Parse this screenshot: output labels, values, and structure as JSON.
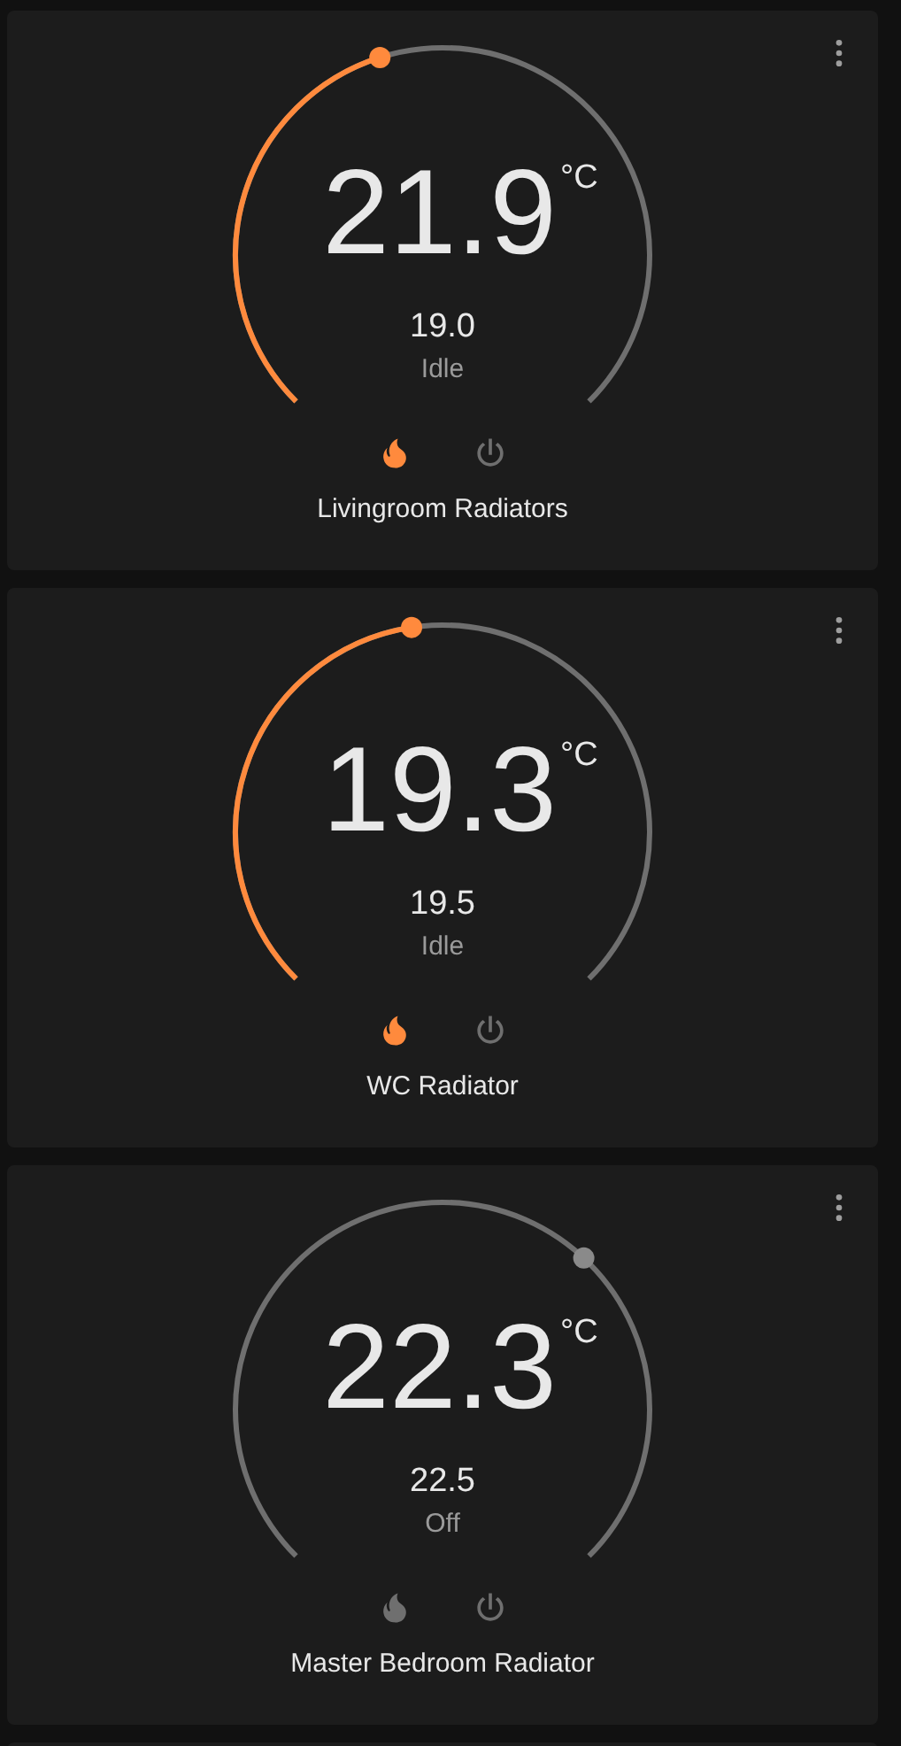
{
  "cards": [
    {
      "name": "Livingroom Radiators",
      "current": "21.9",
      "unit": "°C",
      "target": "19.0",
      "status": "Idle",
      "heating": true
    },
    {
      "name": "WC Radiator",
      "current": "19.3",
      "unit": "°C",
      "target": "19.5",
      "status": "Idle",
      "heating": true
    },
    {
      "name": "Master Bedroom Radiator",
      "current": "22.3",
      "unit": "°C",
      "target": "22.5",
      "status": "Off",
      "heating": false
    }
  ]
}
